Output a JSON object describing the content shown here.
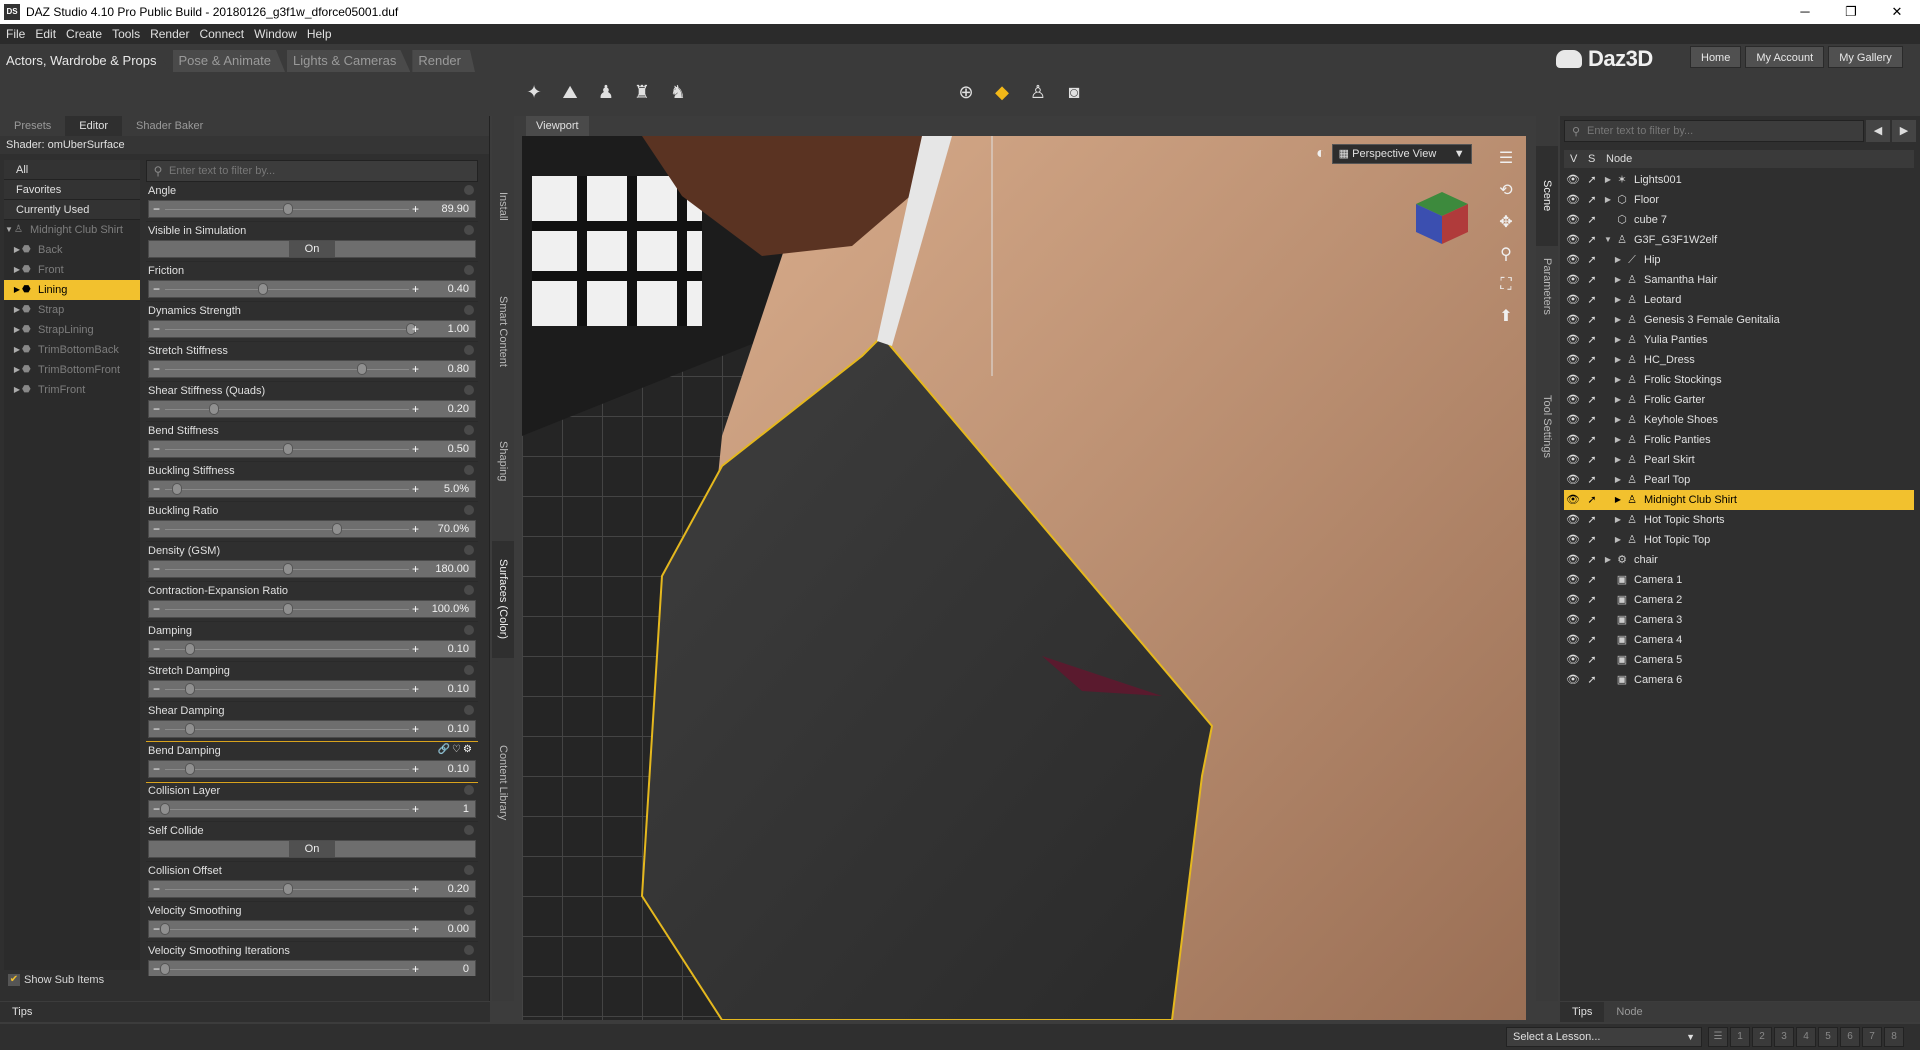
{
  "window": {
    "title": "DAZ Studio 4.10 Pro Public Build - 20180126_g3f1w_dforce05001.duf",
    "icon": "DS",
    "minimize": "─",
    "maximize": "❐",
    "close": "✕"
  },
  "menu": [
    "File",
    "Edit",
    "Create",
    "Tools",
    "Render",
    "Connect",
    "Window",
    "Help"
  ],
  "rooms": [
    "Actors, Wardrobe & Props",
    "Pose & Animate",
    "Lights & Cameras",
    "Render"
  ],
  "brand": {
    "name": "Daz3D"
  },
  "nav_buttons": [
    "Home",
    "My Account",
    "My Gallery"
  ],
  "left_panel": {
    "tabs": [
      "Presets",
      "Editor",
      "Shader Baker"
    ],
    "shader_label": "Shader: omUberSurface",
    "filter_placeholder": "Enter text to filter by...",
    "categories": [
      "All",
      "Favorites",
      "Currently Used"
    ],
    "tree": {
      "root": "Midnight Club Shirt",
      "items": [
        "Back",
        "Front",
        "Lining",
        "Strap",
        "StrapLining",
        "TrimBottomBack",
        "TrimBottomFront",
        "TrimFront"
      ],
      "selected": "Lining"
    },
    "show_sub_items": "Show Sub Items",
    "properties": [
      {
        "name": "Angle",
        "type": "slider",
        "value": "89.90",
        "fraction": 0.5
      },
      {
        "name": "Visible in Simulation",
        "type": "toggle",
        "value": "On"
      },
      {
        "name": "Friction",
        "type": "slider",
        "value": "0.40",
        "fraction": 0.4
      },
      {
        "name": "Dynamics Strength",
        "type": "slider",
        "value": "1.00",
        "fraction": 1.0
      },
      {
        "name": "Stretch Stiffness",
        "type": "slider",
        "value": "0.80",
        "fraction": 0.8
      },
      {
        "name": "Shear Stiffness (Quads)",
        "type": "slider",
        "value": "0.20",
        "fraction": 0.2
      },
      {
        "name": "Bend Stiffness",
        "type": "slider",
        "value": "0.50",
        "fraction": 0.5
      },
      {
        "name": "Buckling Stiffness",
        "type": "slider",
        "value": "5.0%",
        "fraction": 0.05
      },
      {
        "name": "Buckling Ratio",
        "type": "slider",
        "value": "70.0%",
        "fraction": 0.7
      },
      {
        "name": "Density (GSM)",
        "type": "slider",
        "value": "180.00",
        "fraction": 0.5
      },
      {
        "name": "Contraction-Expansion Ratio",
        "type": "slider",
        "value": "100.0%",
        "fraction": 0.5
      },
      {
        "name": "Damping",
        "type": "slider",
        "value": "0.10",
        "fraction": 0.1
      },
      {
        "name": "Stretch Damping",
        "type": "slider",
        "value": "0.10",
        "fraction": 0.1
      },
      {
        "name": "Shear Damping",
        "type": "slider",
        "value": "0.10",
        "fraction": 0.1
      },
      {
        "name": "Bend Damping",
        "type": "slider",
        "value": "0.10",
        "fraction": 0.1,
        "highlight": true
      },
      {
        "name": "Collision Layer",
        "type": "slider",
        "value": "1",
        "fraction": 0.0
      },
      {
        "name": "Self Collide",
        "type": "toggle",
        "value": "On"
      },
      {
        "name": "Collision Offset",
        "type": "slider",
        "value": "0.20",
        "fraction": 0.5
      },
      {
        "name": "Velocity Smoothing",
        "type": "slider",
        "value": "0.00",
        "fraction": 0.0
      },
      {
        "name": "Velocity Smoothing Iterations",
        "type": "slider",
        "value": "0",
        "fraction": 0.0
      }
    ],
    "vertical_tabs": [
      "Install",
      "Smart Content",
      "Shaping",
      "Surfaces (Color)",
      "Content Library"
    ],
    "bottom_tab": "Tips"
  },
  "viewport": {
    "tab": "Viewport",
    "camera": "Perspective View"
  },
  "right_panel": {
    "vertical_tabs": [
      "Scene",
      "Parameters",
      "Tool Settings"
    ],
    "filter_placeholder": "Enter text to filter by...",
    "columns": [
      "V",
      "S",
      "Node"
    ],
    "nodes": [
      {
        "name": "Lights001",
        "indent": 0,
        "icon": "lights-icon",
        "glyph": "✶",
        "expand": true
      },
      {
        "name": "Floor",
        "indent": 0,
        "icon": "floor-icon",
        "glyph": "⬡",
        "expand": true
      },
      {
        "name": "cube 7",
        "indent": 0,
        "icon": "cube-icon",
        "glyph": "⬡",
        "expand": false
      },
      {
        "name": "G3F_G3F1W2elf",
        "indent": 0,
        "icon": "figure-icon",
        "glyph": "♙",
        "expand": true,
        "open": true
      },
      {
        "name": "Hip",
        "indent": 1,
        "icon": "bone-icon",
        "glyph": "⟋",
        "expand": true
      },
      {
        "name": "Samantha Hair",
        "indent": 1,
        "icon": "figure-icon",
        "glyph": "♙",
        "expand": true
      },
      {
        "name": "Leotard",
        "indent": 1,
        "icon": "figure-icon",
        "glyph": "♙",
        "expand": true
      },
      {
        "name": "Genesis 3 Female Genitalia",
        "indent": 1,
        "icon": "figure-icon",
        "glyph": "♙",
        "expand": true
      },
      {
        "name": "Yulia Panties",
        "indent": 1,
        "icon": "figure-icon",
        "glyph": "♙",
        "expand": true
      },
      {
        "name": "HC_Dress",
        "indent": 1,
        "icon": "figure-icon",
        "glyph": "♙",
        "expand": true
      },
      {
        "name": "Frolic Stockings",
        "indent": 1,
        "icon": "figure-icon",
        "glyph": "♙",
        "expand": true
      },
      {
        "name": "Frolic Garter",
        "indent": 1,
        "icon": "figure-icon",
        "glyph": "♙",
        "expand": true
      },
      {
        "name": "Keyhole Shoes",
        "indent": 1,
        "icon": "figure-icon",
        "glyph": "♙",
        "expand": true
      },
      {
        "name": "Frolic Panties",
        "indent": 1,
        "icon": "figure-icon",
        "glyph": "♙",
        "expand": true
      },
      {
        "name": "Pearl Skirt",
        "indent": 1,
        "icon": "figure-icon",
        "glyph": "♙",
        "expand": true
      },
      {
        "name": "Pearl Top",
        "indent": 1,
        "icon": "figure-icon",
        "glyph": "♙",
        "expand": true
      },
      {
        "name": "Midnight Club Shirt",
        "indent": 1,
        "icon": "figure-icon",
        "glyph": "♙",
        "expand": true,
        "selected": true
      },
      {
        "name": "Hot Topic Shorts",
        "indent": 1,
        "icon": "figure-icon",
        "glyph": "♙",
        "expand": true
      },
      {
        "name": "Hot Topic Top",
        "indent": 1,
        "icon": "figure-icon",
        "glyph": "♙",
        "expand": true
      },
      {
        "name": "chair",
        "indent": 0,
        "icon": "group-icon",
        "glyph": "⚙",
        "expand": true
      },
      {
        "name": "Camera 1",
        "indent": 0,
        "icon": "camera-icon",
        "glyph": "▣",
        "expand": false
      },
      {
        "name": "Camera 2",
        "indent": 0,
        "icon": "camera-icon",
        "glyph": "▣",
        "expand": false
      },
      {
        "name": "Camera 3",
        "indent": 0,
        "icon": "camera-icon",
        "glyph": "▣",
        "expand": false
      },
      {
        "name": "Camera 4",
        "indent": 0,
        "icon": "camera-icon",
        "glyph": "▣",
        "expand": false
      },
      {
        "name": "Camera 5",
        "indent": 0,
        "icon": "camera-icon",
        "glyph": "▣",
        "expand": false
      },
      {
        "name": "Camera 6",
        "indent": 0,
        "icon": "camera-icon",
        "glyph": "▣",
        "expand": false
      }
    ],
    "bottom_tabs": [
      "Tips",
      "Node"
    ]
  },
  "status": {
    "lesson": "Select a Lesson..."
  },
  "colors": {
    "accent": "#f2c12e",
    "panel": "#2f2f2f",
    "chrome": "#3a3a3a"
  }
}
